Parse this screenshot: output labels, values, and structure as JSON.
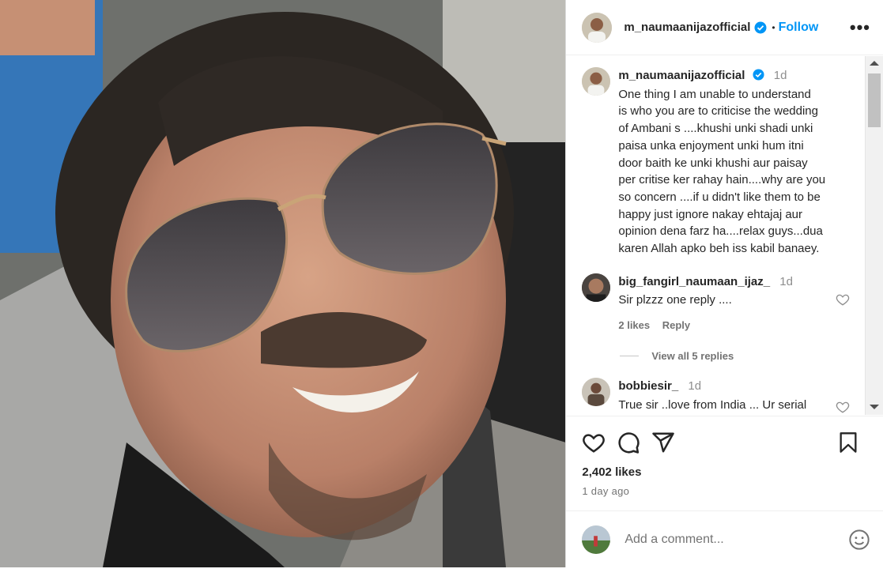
{
  "post": {
    "username": "m_naumaanijazofficial",
    "follow_label": "Follow",
    "separator": "•",
    "more_label": "•••"
  },
  "caption": {
    "username": "m_naumaanijazofficial",
    "time": "1d",
    "lines": [
      "One thing I am unable to understand",
      "is who you are to criticise the wedding",
      "of Ambani s ....khushi unki shadi unki",
      "paisa unka enjoyment unki hum itni",
      "door baith ke unki khushi aur paisay",
      "per critise ker rahay hain....why are you",
      "so concern ....if u didn't like them to be",
      "happy just ignore nakay ehtajaj aur",
      "opinion dena farz ha....relax guys...dua",
      "karen Allah apko beh iss kabil banaey."
    ]
  },
  "comments": [
    {
      "username": "big_fangirl_naumaan_ijaz_",
      "time": "1d",
      "text": "Sir plzzz one reply ....",
      "likes": "2 likes",
      "reply": "Reply",
      "view_replies": "View all 5 replies"
    },
    {
      "username": "bobbiesir_",
      "time": "1d",
      "text": "True sir ..love from India ... Ur serial"
    }
  ],
  "stats": {
    "likes": "2,402 likes",
    "posted": "1 day ago"
  },
  "add_comment": {
    "placeholder": "Add a comment..."
  },
  "icons": [
    "heart-icon",
    "comment-icon",
    "share-icon",
    "bookmark-icon",
    "emoji-icon",
    "verified-badge-icon",
    "more-icon"
  ],
  "colors": {
    "accent": "#0095f6",
    "text": "#262626",
    "muted": "#737373",
    "verified": "#0095f6"
  }
}
